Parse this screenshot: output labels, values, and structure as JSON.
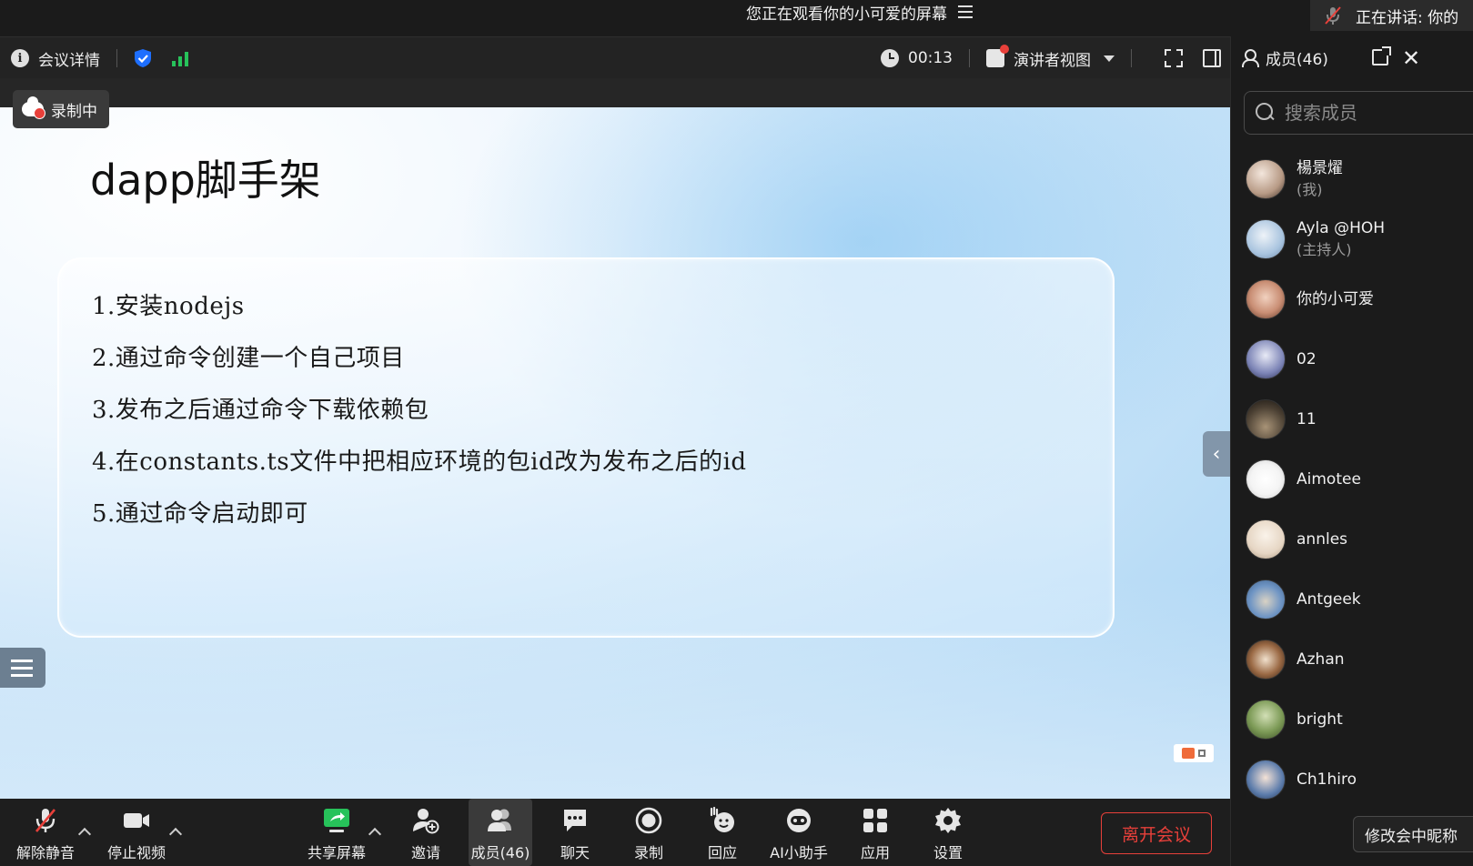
{
  "top_bar": {
    "viewing_text": "您正在观看你的小可爱的屏幕",
    "speaking_text": "正在讲话: 你的"
  },
  "info_bar": {
    "meeting_details": "会议详情",
    "timer": "00:13",
    "view_mode": "演讲者视图"
  },
  "recording_badge": "录制中",
  "slide": {
    "title": "dapp脚手架",
    "items": [
      "1.安装nodejs",
      "2.通过命令创建一个自己项目",
      "3.发布之后通过命令下载依赖包",
      "4.在constants.ts文件中把相应环境的包id改为发布之后的id",
      "5.通过命令启动即可"
    ]
  },
  "controls": {
    "unmute": "解除静音",
    "stop_video": "停止视频",
    "share_screen": "共享屏幕",
    "invite": "邀请",
    "members": "成员(46)",
    "chat": "聊天",
    "record": "录制",
    "react": "回应",
    "ai_assistant": "AI小助手",
    "apps": "应用",
    "settings": "设置",
    "leave": "离开会议"
  },
  "member_panel": {
    "title": "成员(46)",
    "search_placeholder": "搜索成员",
    "members": [
      {
        "name": "楊景燿",
        "sub": "(我)",
        "color": "#b79a85"
      },
      {
        "name": "Ayla @HOH",
        "sub": "(主持人)",
        "color": "#a9c4df"
      },
      {
        "name": "你的小可爱",
        "sub": "",
        "color": "#c98e74"
      },
      {
        "name": "02",
        "sub": "",
        "color": "#7c84b6"
      },
      {
        "name": "11",
        "sub": "",
        "color": "#4b4033"
      },
      {
        "name": "Aimotee",
        "sub": "",
        "color": "#f4f4f4"
      },
      {
        "name": "annles",
        "sub": "",
        "color": "#e6d6c4"
      },
      {
        "name": "Antgeek",
        "sub": "",
        "color": "#6f95c4"
      },
      {
        "name": "Azhan",
        "sub": "",
        "color": "#9b6a45"
      },
      {
        "name": "bright",
        "sub": "",
        "color": "#7c9a56"
      },
      {
        "name": "Ch1hiro",
        "sub": "",
        "color": "#5c7cab"
      }
    ],
    "nickname_button": "修改会中昵称"
  },
  "colors": {
    "accent_blue": "#1e6fff",
    "signal_green": "#27c25a",
    "leave_red": "#e8403a",
    "share_green": "#27c25a"
  }
}
